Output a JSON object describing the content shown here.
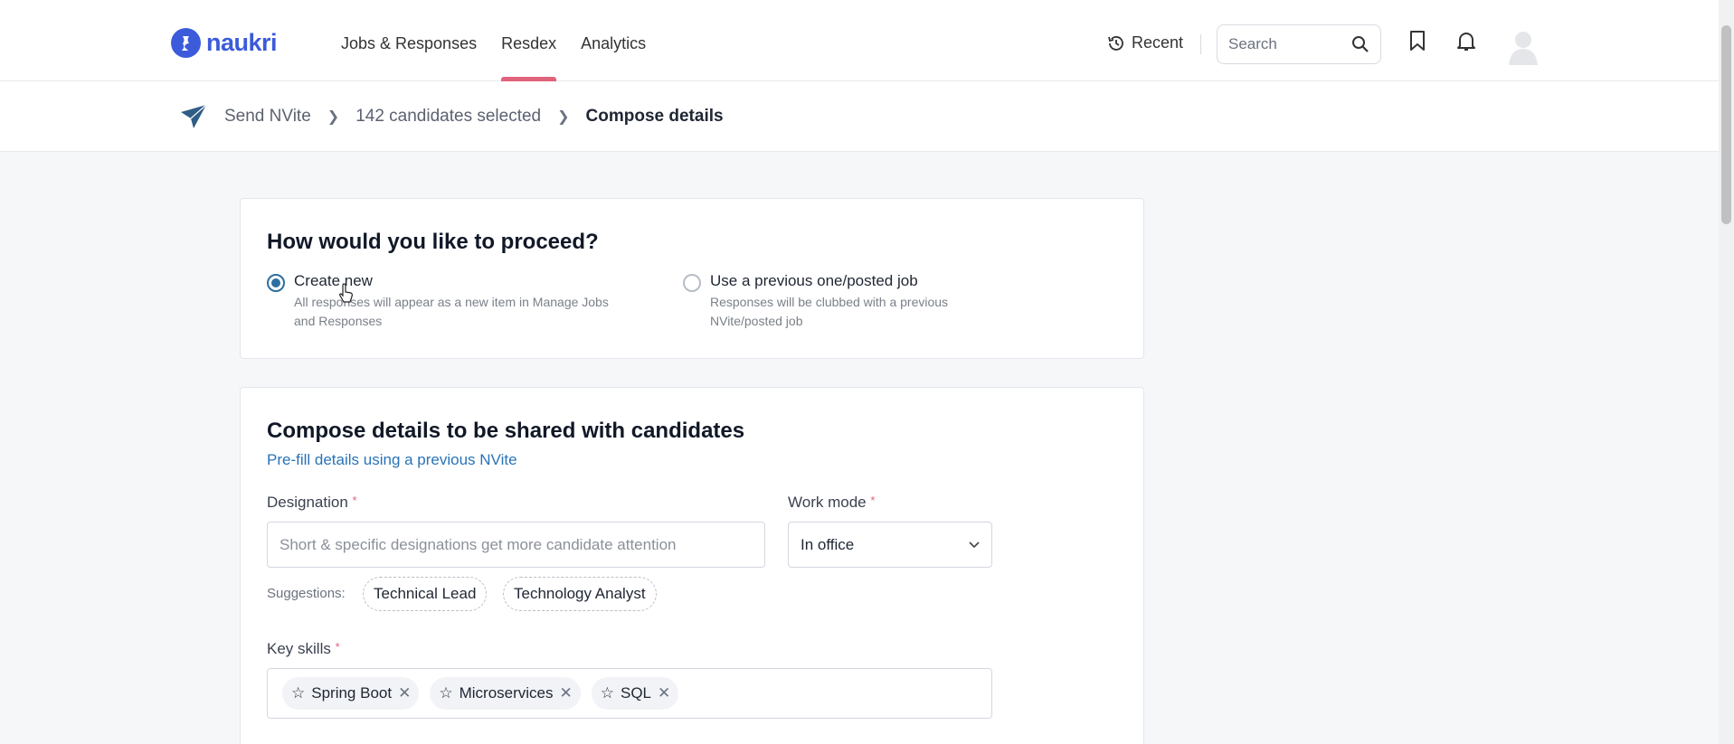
{
  "header": {
    "logo_text": "naukri",
    "nav": [
      {
        "label": "Jobs & Responses"
      },
      {
        "label": "Resdex"
      },
      {
        "label": "Analytics"
      }
    ],
    "recent_label": "Recent",
    "search_placeholder": "Search",
    "icons": [
      "clock-icon",
      "search-icon",
      "bookmark-icon",
      "bell-icon",
      "avatar"
    ]
  },
  "breadcrumb": {
    "icon": "paper-plane-icon",
    "items": [
      "Send NVite",
      "142 candidates selected",
      "Compose details"
    ]
  },
  "proceed": {
    "title": "How would you like to proceed?",
    "options": [
      {
        "title": "Create new",
        "desc": "All responses will appear as a new item in Manage Jobs and Responses",
        "selected": true
      },
      {
        "title": "Use a previous one/posted job",
        "desc": "Responses will be clubbed with a previous NVite/posted job",
        "selected": false
      }
    ]
  },
  "compose": {
    "title": "Compose details to be shared with candidates",
    "prefill_link": "Pre-fill details using a previous NVite",
    "designation_label": "Designation",
    "designation_placeholder": "Short & specific designations get more candidate attention",
    "workmode_label": "Work mode",
    "workmode_value": "In office",
    "required_mark": "*",
    "suggestions_label": "Suggestions:",
    "suggestions": [
      "Technical Lead",
      "Technology Analyst"
    ],
    "keyskills_label": "Key skills",
    "skills": [
      "Spring Boot",
      "Microservices",
      "SQL"
    ]
  },
  "colors": {
    "brand": "#3b5bdb",
    "active_tab": "#e0627b",
    "link": "#2a73b8",
    "radio": "#2d6fa0"
  }
}
